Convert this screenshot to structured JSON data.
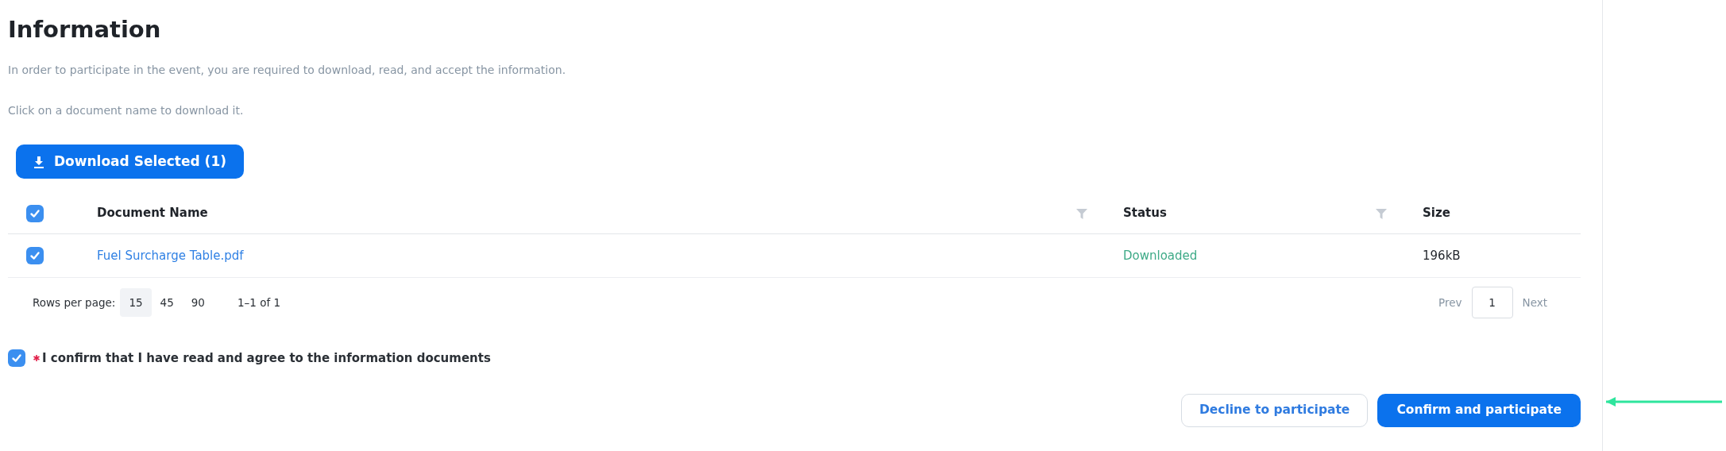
{
  "title": "Information",
  "paragraphs": [
    "In order to participate in the event, you are required to download, read, and accept the information.",
    "Click on a document name to download it."
  ],
  "download_button": {
    "label": "Download Selected (1)"
  },
  "table": {
    "select_all": {
      "checked": true
    },
    "columns": [
      {
        "label": "Document Name",
        "filterable": true
      },
      {
        "label": "Status",
        "filterable": true
      },
      {
        "label": "Size",
        "filterable": false
      }
    ],
    "rows": [
      {
        "checked": true,
        "name": "Fuel Surcharge Table.pdf",
        "status": "Downloaded",
        "size": "196kB"
      }
    ]
  },
  "pagination": {
    "label": "Rows per page:",
    "options": [
      {
        "label": "15",
        "selected": true
      },
      {
        "label": "45",
        "selected": false
      },
      {
        "label": "90",
        "selected": false
      }
    ],
    "range": "1–1 of 1",
    "prev": "Prev",
    "page": "1",
    "next": "Next"
  },
  "confirm": {
    "checked": true,
    "required": true,
    "label": "I confirm that I have read and agree to the information documents"
  },
  "buttons": [
    {
      "kind": "outline",
      "label": "Decline to participate"
    },
    {
      "kind": "primary",
      "label": "Confirm and participate"
    }
  ]
}
